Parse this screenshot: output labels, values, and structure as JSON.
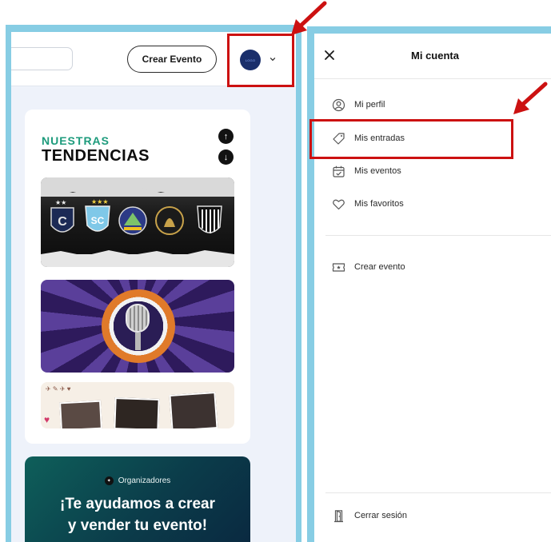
{
  "header": {
    "create_event_label": "Crear Evento",
    "avatar_logo_text": "LOGO"
  },
  "trends": {
    "title_small": "NUESTRAS",
    "title_big": "TENDENCIAS",
    "up_icon": "arrow-up-icon",
    "down_icon": "arrow-down-icon"
  },
  "organizers": {
    "tag": "Organizadores",
    "title_line1": "¡Te ayudamos a crear",
    "title_line2": "y vender tu evento!"
  },
  "account_menu": {
    "title": "Mi cuenta",
    "items": [
      {
        "label": "Mi perfil",
        "icon": "user-circle-icon"
      },
      {
        "label": "Mis entradas",
        "icon": "ticket-icon"
      },
      {
        "label": "Mis eventos",
        "icon": "calendar-check-icon"
      },
      {
        "label": "Mis favoritos",
        "icon": "heart-icon"
      }
    ],
    "create_event": {
      "label": "Crear evento",
      "icon": "ticket-star-icon"
    },
    "logout": {
      "label": "Cerrar sesión",
      "icon": "door-icon"
    }
  },
  "colors": {
    "frame": "#87cde4",
    "highlight": "#cc1111",
    "trend_accent": "#1d9b7c",
    "avatar": "#1a2f6b"
  }
}
